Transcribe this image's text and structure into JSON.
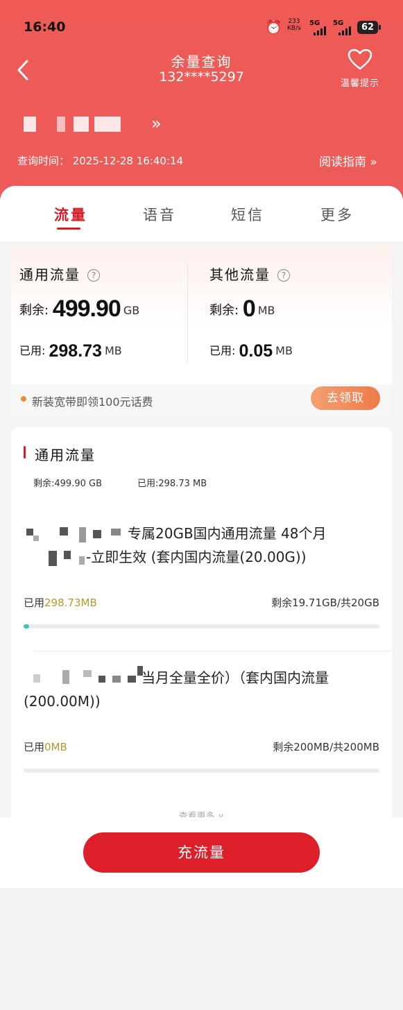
{
  "status_bar": {
    "time": "16:40",
    "net_speed_value": "233",
    "net_speed_unit": "KB/s",
    "sig1": "5G",
    "sig2": "5G",
    "battery": "62"
  },
  "header": {
    "title": "余量查询",
    "phone": "132****5297",
    "tip_label": "温馨提示",
    "query_time": "查询时间： 2025-12-28 16:40:14",
    "guide": "阅读指南 »",
    "more_arrows": "»"
  },
  "tabs": [
    {
      "label": "流量"
    },
    {
      "label": "语音"
    },
    {
      "label": "短信"
    },
    {
      "label": "更多"
    }
  ],
  "summary": {
    "general": {
      "title": "通用流量",
      "remain_label": "剩余:",
      "remain_value": "499.90",
      "remain_unit": "GB",
      "used_label": "已用:",
      "used_value": "298.73",
      "used_unit": "MB"
    },
    "other": {
      "title": "其他流量",
      "remain_label": "剩余:",
      "remain_value": "0",
      "remain_unit": "MB",
      "used_label": "已用:",
      "used_value": "0.05",
      "used_unit": "MB"
    },
    "promo_text": "新装宽带即领100元话费",
    "promo_button": "去领取"
  },
  "detail": {
    "title": "通用流量",
    "remain_summary": "剩余:499.90 GB",
    "used_summary": "已用:298.73 MB",
    "packages": [
      {
        "name_line1": "专属20GB国内通用流量 48个月",
        "name_line2": "-立即生效 (套内国内流量(20.00G))",
        "used_label": "已用",
        "used_value": "298.73MB",
        "remain": "剩余19.71GB/共20GB",
        "progress": 0.015
      },
      {
        "name_line1": "当月全量全价）（套内国内流量",
        "name_line2": "(200.00M))",
        "used_label": "已用",
        "used_value": "0MB",
        "remain": "剩余200MB/共200MB",
        "progress": 0
      }
    ],
    "see_more": "查看更多 ∨"
  },
  "bottom": {
    "recharge": "充流量"
  },
  "colors": {
    "header_red": "#ec5b5a",
    "accent_red": "#d71c24",
    "cta_red": "#dd1f2a",
    "promo_orange": "#ee7b4a",
    "progress_teal": "#3cc5a8",
    "used_gold": "#b8982a"
  }
}
